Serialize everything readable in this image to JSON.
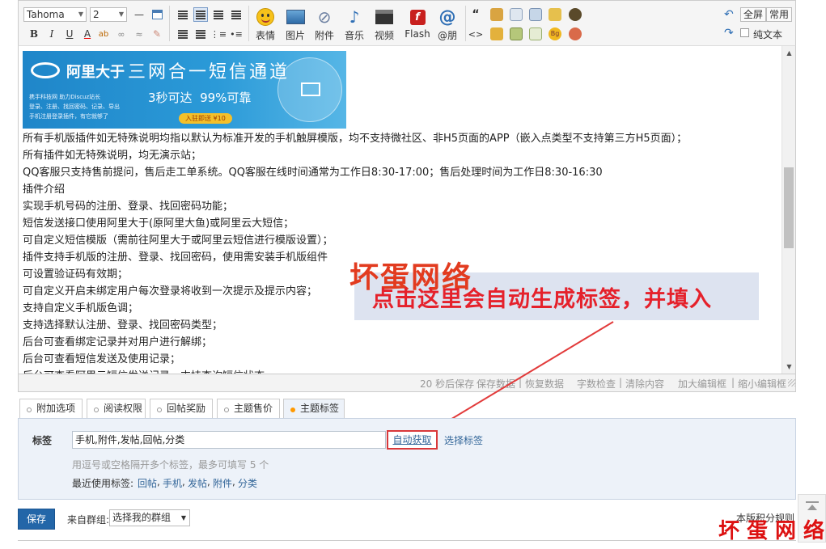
{
  "toolbar": {
    "font_family": "Tahoma",
    "font_size": "2",
    "big_buttons": [
      {
        "icon": "smiley-icon",
        "label": "表情"
      },
      {
        "icon": "image-icon",
        "label": "图片"
      },
      {
        "icon": "paperclip-icon",
        "label": "附件"
      },
      {
        "icon": "music-note-icon",
        "label": "音乐"
      },
      {
        "icon": "video-clapper-icon",
        "label": "视频"
      },
      {
        "icon": "flash-icon",
        "label": "Flash"
      },
      {
        "icon": "at-icon",
        "label": "@朋"
      }
    ],
    "fullscreen_label": "全屏",
    "common_label": "常用",
    "plaintext_label": "纯文本"
  },
  "editor": {
    "banner": {
      "brand": "阿里大于",
      "headline": "三网合一短信通道",
      "slogan": "3秒可达  99%可靠",
      "line1": "携手科技网 助力Discuz站长",
      "line2": "登录、注册、找回密码、记录、导出",
      "line3": "手机注册登录插件，有它就够了",
      "badge": "入驻即送 ¥10"
    },
    "lines": [
      "所有手机版插件如无特殊说明均指以默认为标准开发的手机触屏模版，均不支持微社区、非H5页面的APP（嵌入点类型不支持第三方H5页面）；",
      "所有插件如无特殊说明，均无演示站；",
      "QQ客服只支持售前提问，售后走工单系统。QQ客服在线时间通常为工作日8:30-17:00；售后处理时间为工作日8:30-16:30",
      "插件介绍",
      "实现手机号码的注册、登录、找回密码功能；",
      "短信发送接口使用阿里大于(原阿里大鱼)或阿里云大短信；",
      "可自定义短信模版（需前往阿里大于或阿里云短信进行模版设置）；",
      "插件支持手机版的注册、登录、找回密码，使用需安装手机版组件",
      "可设置验证码有效期；",
      "可自定义开启未绑定用户每次登录将收到一次提示及提示内容；",
      "支持自定义手机版色调；",
      "支持选择默认注册、登录、找回密码类型；",
      "后台可查看绑定记录并对用户进行解绑；",
      "后台可查看短信发送及使用记录；",
      "后台可查看阿里云短信发送记录，支持查询短信状态"
    ]
  },
  "statusbar": {
    "autosave": "20 秒后保存",
    "save_data": "保存数据",
    "restore_data": "恢复数据",
    "word_check": "字数检查",
    "clear_content": "清除内容",
    "enlarge": "加大编辑框",
    "shrink": "缩小编辑框"
  },
  "annotation": {
    "watermark": "坏蛋网络",
    "callout": "点击这里会自动生成标签，并填入"
  },
  "tabs": [
    "附加选项",
    "阅读权限",
    "回帖奖励",
    "主题售价",
    "主题标签"
  ],
  "tagpanel": {
    "label": "标签",
    "input_value": "手机,附件,发帖,回帖,分类",
    "auto_button": "自动获取",
    "choose_link": "选择标签",
    "hint": "用逗号或空格隔开多个标签，最多可填写 5 个",
    "recent_label": "最近使用标签:",
    "recent_tags": [
      "回帖",
      "手机",
      "发帖",
      "附件",
      "分类"
    ]
  },
  "bottom": {
    "save": "保存",
    "from_group_label": "来自群组:",
    "group_select": "选择我的群组",
    "rules_link": "本版积分规则"
  },
  "corner_watermark": "坏蛋网络",
  "colors": {
    "accent": "#2366a8",
    "callout": "#e5212b",
    "link": "#336699"
  }
}
